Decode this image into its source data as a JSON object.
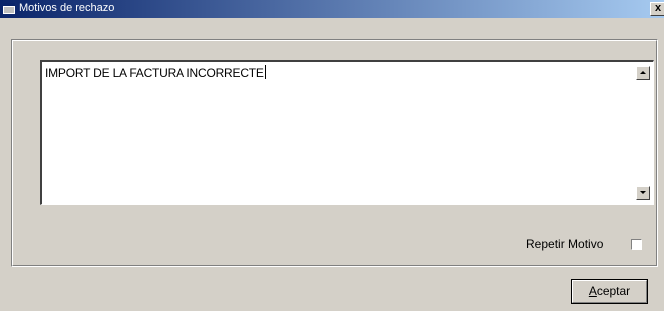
{
  "window": {
    "title": "Motivos de rechazo",
    "close_label": "x"
  },
  "textarea": {
    "value": "IMPORT DE LA FACTURA INCORRECTE"
  },
  "repeat": {
    "label": "Repetir Motivo",
    "checked": false
  },
  "accept_button": {
    "mnemonic": "A",
    "rest": "ceptar"
  },
  "icons": {
    "window": "app-window-icon",
    "close": "close-icon",
    "scroll_up": "scroll-up-arrow-icon",
    "scroll_down": "scroll-down-arrow-icon"
  },
  "colors": {
    "titlebar_start": "#0a246a",
    "titlebar_end": "#a6caf0",
    "dialog_bg": "#d4d0c8"
  }
}
